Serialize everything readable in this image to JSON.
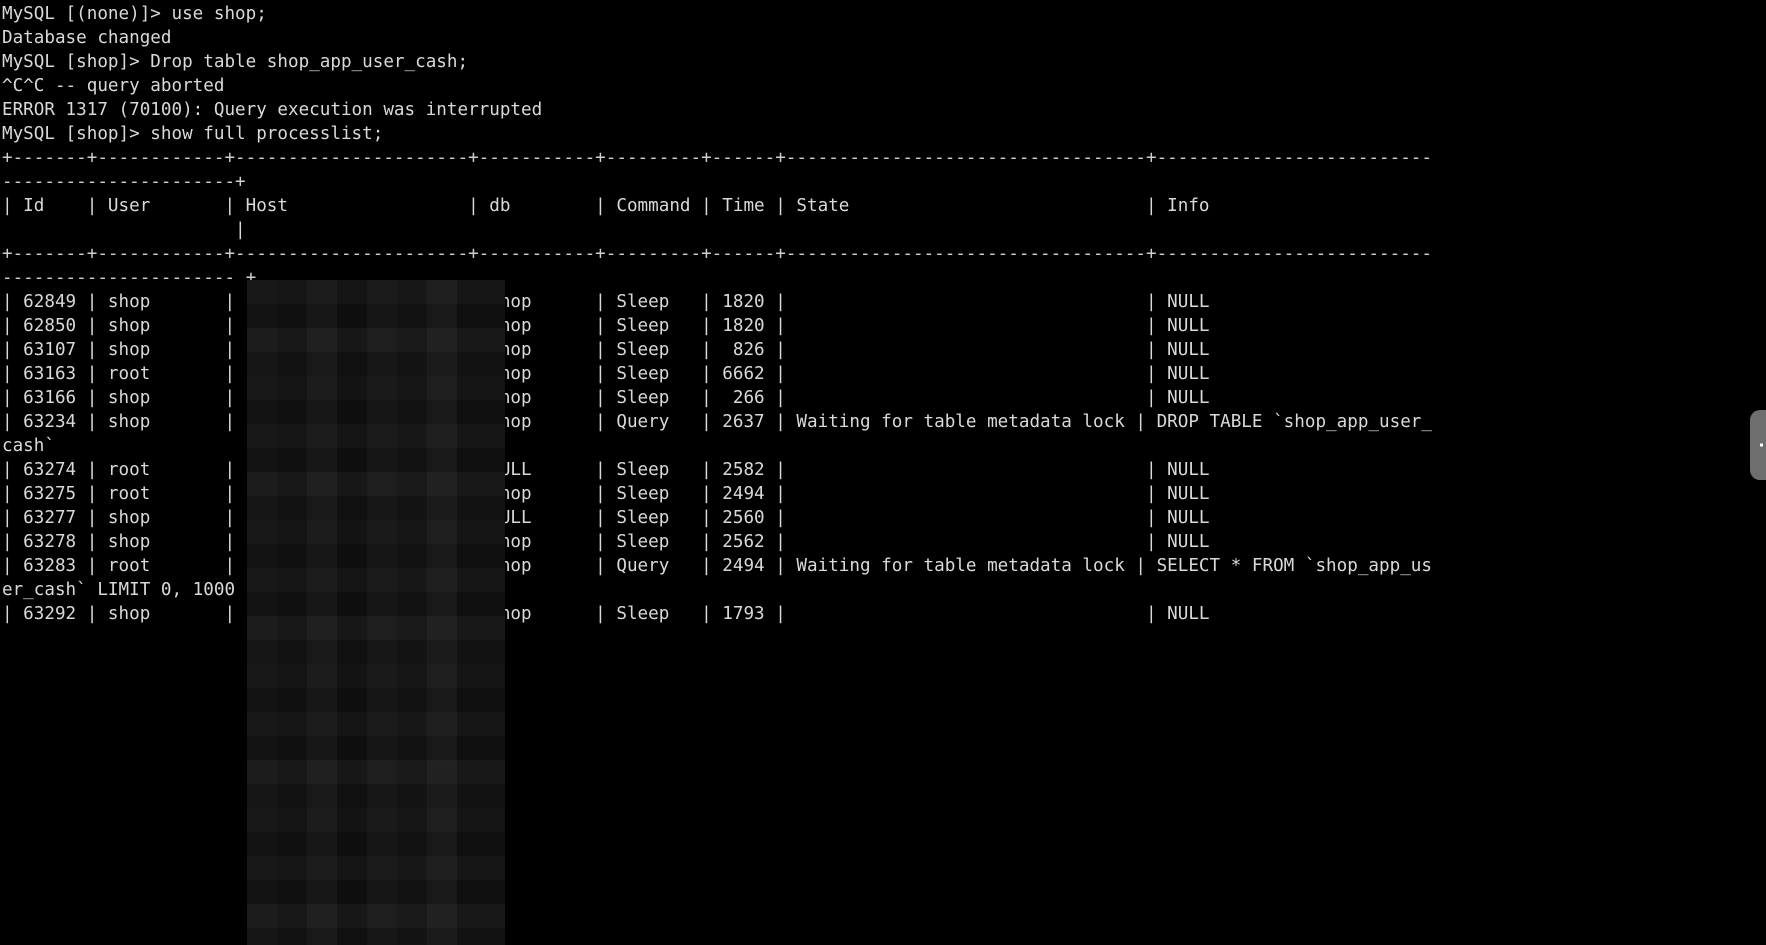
{
  "terminal": {
    "app": "mysql-client-terminal",
    "background_color": "#000000",
    "foreground_color": "#d9d9d9",
    "prompt_none": "MySQL [(none)]> ",
    "prompt_shop": "MySQL [shop]> "
  },
  "session": {
    "lines": [
      "MySQL [(none)]> use shop;",
      "Database changed",
      "MySQL [shop]> Drop table shop_app_user_cash;",
      "^C^C -- query aborted",
      "ERROR 1317 (70100): Query execution was interrupted",
      "MySQL [shop]> show full processlist;"
    ],
    "commands": [
      "use shop;",
      "Drop table shop_app_user_cash;",
      "show full processlist;"
    ],
    "database_changed_message": "Database changed",
    "abort_message": "^C^C -- query aborted",
    "error_message": "ERROR 1317 (70100): Query execution was interrupted",
    "error_code": "1317",
    "error_sqlstate": "70100"
  },
  "processlist": {
    "columns": [
      "Id",
      "User",
      "Host",
      "db",
      "Command",
      "Time",
      "State",
      "Info"
    ],
    "separator_row_1": "+-------+------------+----------------------+-----------+---------+------+----------------------------------+--------------------------",
    "separator_row_1_wrap": "----------------------+",
    "header_row": "| Id    | User       | Host                 | db        | Command | Time | State                            | Info",
    "header_row_wrap": "                      |",
    "separator_row_2": "+-------+------------+----------------------+-----------+---------+------+----------------------------------+--------------------------",
    "separator_row_2_wrap": "---------------------- +",
    "rows": [
      {
        "id": "62849",
        "user": "shop",
        "host": "[redacted]",
        "db": "shop",
        "command": "Sleep",
        "time": "1820",
        "state": "",
        "info": "NULL"
      },
      {
        "id": "62850",
        "user": "shop",
        "host": "[redacted]",
        "db": "shop",
        "command": "Sleep",
        "time": "1820",
        "state": "",
        "info": "NULL"
      },
      {
        "id": "63107",
        "user": "shop",
        "host": "[redacted]",
        "db": "shop",
        "command": "Sleep",
        "time": "826",
        "state": "",
        "info": "NULL"
      },
      {
        "id": "63163",
        "user": "root",
        "host": "[redacted]",
        "db": "shop",
        "command": "Sleep",
        "time": "6662",
        "state": "",
        "info": "NULL"
      },
      {
        "id": "63166",
        "user": "shop",
        "host": "[redacted]",
        "db": "shop",
        "command": "Sleep",
        "time": "266",
        "state": "",
        "info": "NULL"
      },
      {
        "id": "63234",
        "user": "shop",
        "host": "[redacted]",
        "db": "shop",
        "command": "Query",
        "time": "2637",
        "state": "Waiting for table metadata lock",
        "info": "DROP TABLE `shop_app_user_cash`"
      },
      {
        "id": "63274",
        "user": "root",
        "host": "[redacted]",
        "db": "NULL",
        "command": "Sleep",
        "time": "2582",
        "state": "",
        "info": "NULL"
      },
      {
        "id": "63275",
        "user": "root",
        "host": "[redacted]",
        "db": "shop",
        "command": "Sleep",
        "time": "2494",
        "state": "",
        "info": "NULL"
      },
      {
        "id": "63277",
        "user": "shop",
        "host": "[redacted]",
        "db": "NULL",
        "command": "Sleep",
        "time": "2560",
        "state": "",
        "info": "NULL"
      },
      {
        "id": "63278",
        "user": "shop",
        "host": "[redacted]",
        "db": "shop",
        "command": "Sleep",
        "time": "2562",
        "state": "",
        "info": "NULL"
      },
      {
        "id": "63283",
        "user": "root",
        "host": "[redacted]",
        "db": "shop",
        "command": "Query",
        "time": "2494",
        "state": "Waiting for table metadata lock",
        "info": "SELECT * FROM `shop_app_user_cash` LIMIT 0, 1000"
      },
      {
        "id": "63292",
        "user": "shop",
        "host": "[redacted]",
        "db": "shop",
        "command": "Sleep",
        "time": "1793",
        "state": "",
        "info": "NULL"
      }
    ],
    "rendered_lines": [
      "| 62849 | shop       |                      | shop      | Sleep   | 1820 |                                  | NULL",
      "| 62850 | shop       |                      | shop      | Sleep   | 1820 |                                  | NULL",
      "| 63107 | shop       |                      | shop      | Sleep   |  826 |                                  | NULL",
      "| 63163 | root       |                      | shop      | Sleep   | 6662 |                                  | NULL",
      "| 63166 | shop       |                      | shop      | Sleep   |  266 |                                  | NULL",
      "| 63234 | shop       |                      | shop      | Query   | 2637 | Waiting for table metadata lock | DROP TABLE `shop_app_user_",
      "cash`",
      "| 63274 | root       |                      | NULL      | Sleep   | 2582 |                                  | NULL",
      "| 63275 | root       |                      | shop      | Sleep   | 2494 |                                  | NULL",
      "| 63277 | shop       |                      | NULL      | Sleep   | 2560 |                                  | NULL",
      "| 63278 | shop       |                      | shop      | Sleep   | 2562 |                                  | NULL",
      "| 63283 | root       |                      | shop      | Query   | 2494 | Waiting for table metadata lock | SELECT * FROM `shop_app_us",
      "er_cash` LIMIT 0, 1000 |",
      "| 63292 | shop       |                      | shop      | Sleep   | 1793 |                                  | NULL"
    ]
  },
  "scrollbar": {
    "name": "vertical-scrollbar",
    "color": "#6e6e6e"
  }
}
